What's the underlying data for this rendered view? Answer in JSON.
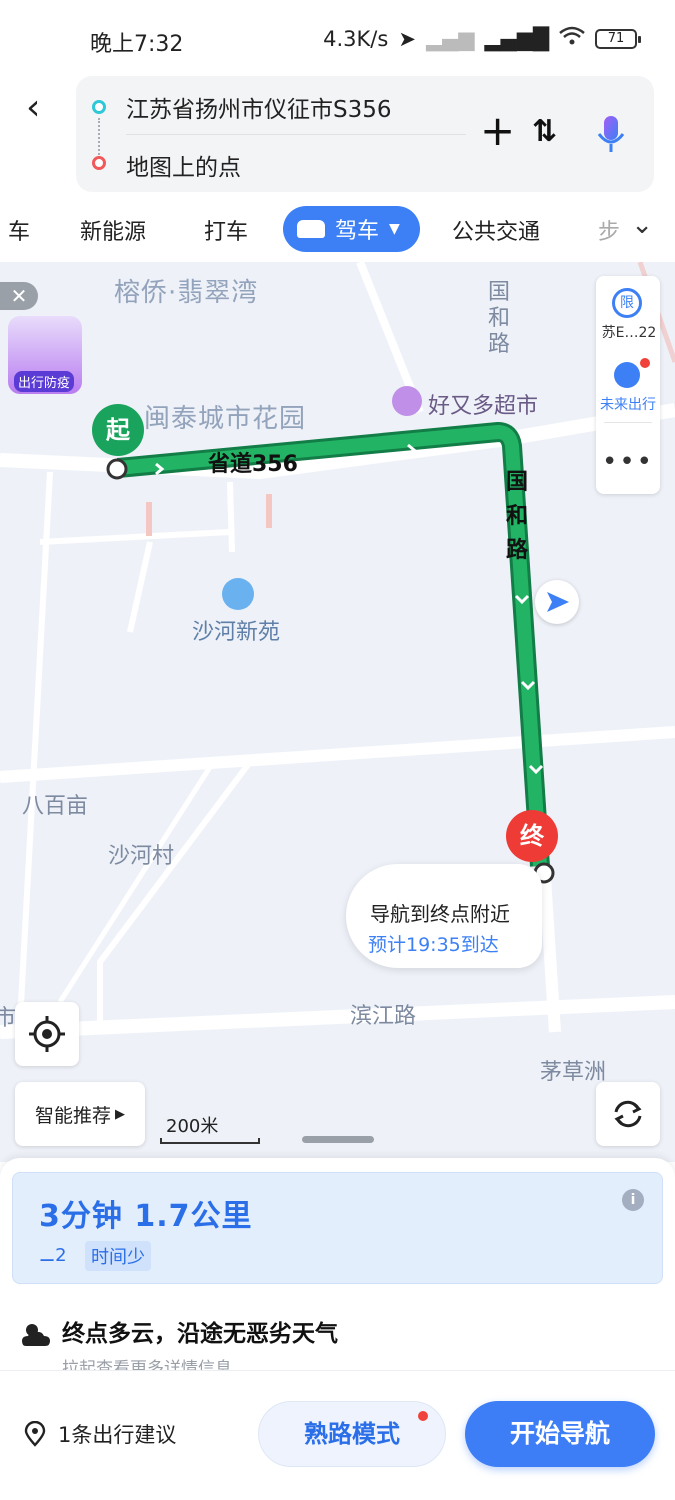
{
  "status_bar": {
    "time": "晚上7:32",
    "network_speed": "4.3K/s",
    "battery": "71",
    "icons": [
      "location-arrow-icon",
      "signal-icon",
      "hd-signal-icon",
      "wifi-icon",
      "battery-icon"
    ]
  },
  "route_input": {
    "origin": "江苏省扬州市仪征市S356",
    "destination": "地图上的点"
  },
  "tabs": {
    "items": [
      "车",
      "新能源",
      "打车",
      "驾车",
      "公共交通",
      "步"
    ],
    "active": "驾车"
  },
  "map": {
    "labels": {
      "community1": "榕侨·翡翠湾",
      "community2": "闽泰城市花园",
      "road_guohe": "国和路",
      "supermarket": "好又多超市",
      "residence": "沙河新苑",
      "babaimu": "八百亩",
      "shahecun": "沙河村",
      "binjiang": "滨江路",
      "maocaozhou": "茅草洲",
      "edge_left": "市"
    },
    "route_labels": {
      "s356": "省道356",
      "guohe": "国和路"
    },
    "pins": {
      "start": "起",
      "end": "终"
    },
    "promo_badge": "出行防疫",
    "side_panel": {
      "limit": "限",
      "plate": "苏E…22",
      "future": "未来出行"
    },
    "tip": {
      "title": "导航到终点附近",
      "eta": "预计19:35到达"
    },
    "smart_recommend": "智能推荐",
    "scale": "200米",
    "colors": {
      "route": "#1fa35f",
      "accent": "#3d80f5"
    }
  },
  "route_summary": {
    "duration_distance": "3分钟 1.7公里",
    "traffic_lights": "2",
    "tag": "时间少"
  },
  "weather": {
    "title": "终点多云，沿途无恶劣天气",
    "subtitle": "拉起查看更多详情信息"
  },
  "bottom_bar": {
    "advice": "1条出行建议",
    "familiar_mode": "熟路模式",
    "start_nav": "开始导航"
  }
}
